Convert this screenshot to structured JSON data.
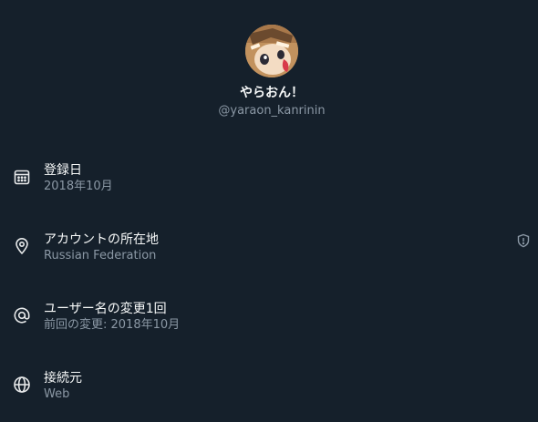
{
  "profile": {
    "display_name": "やらおん！",
    "handle": "@yaraon_kanrinin"
  },
  "rows": [
    {
      "icon": "calendar-icon",
      "title": "登録日",
      "subtitle": "2018年10月"
    },
    {
      "icon": "location-pin-icon",
      "title": "アカウントの所在地",
      "subtitle": "Russian Federation",
      "trailing_icon": "shield-info-icon"
    },
    {
      "icon": "at-sign-icon",
      "title": "ユーザー名の変更1回",
      "subtitle": "前回の変更: 2018年10月"
    },
    {
      "icon": "globe-icon",
      "title": "接続元",
      "subtitle": "Web"
    }
  ],
  "colors": {
    "background": "#15202b",
    "primary_text": "#f7f9f9",
    "secondary_text": "#8b98a5"
  }
}
